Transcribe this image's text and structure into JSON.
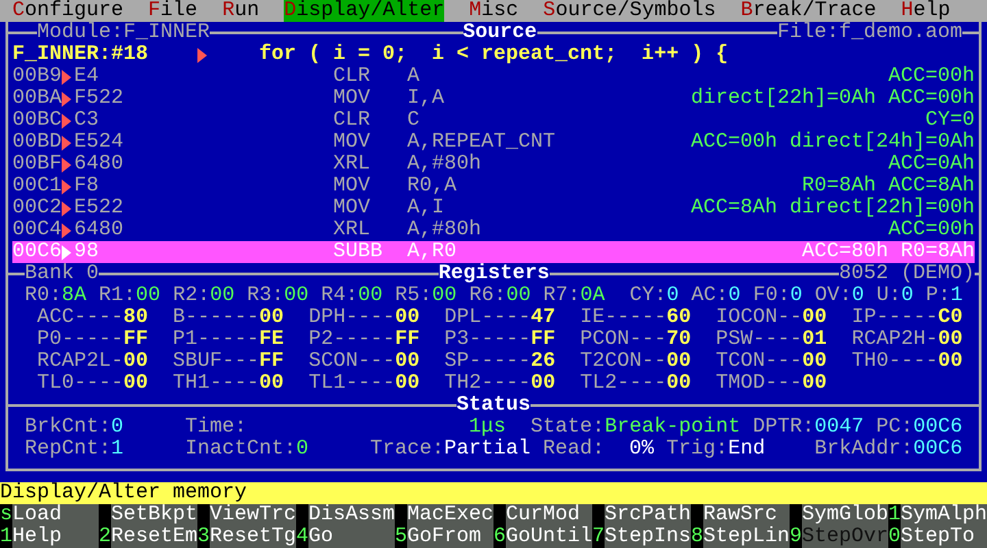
{
  "menu": [
    {
      "label": "Configure",
      "selected": false
    },
    {
      "label": "File",
      "selected": false
    },
    {
      "label": "Run",
      "selected": false
    },
    {
      "label": "Display/Alter",
      "selected": true
    },
    {
      "label": "Misc",
      "selected": false
    },
    {
      "label": "Source/Symbols",
      "selected": false
    },
    {
      "label": "Break/Trace",
      "selected": false
    },
    {
      "label": "Help",
      "selected": false
    }
  ],
  "source_panel": {
    "module": "Module:F_INNER",
    "title": "Source",
    "file": "File:f_demo.aom",
    "source_line": {
      "label": "F_INNER:#18",
      "code": "for ( i = 0;  i < repeat_cnt;  i++ ) {"
    },
    "lines": [
      {
        "address": "00B9",
        "bytes": "E4",
        "mnemonic": "CLR",
        "operands": "A",
        "effect": "ACC=00h",
        "current": false
      },
      {
        "address": "00BA",
        "bytes": "F522",
        "mnemonic": "MOV",
        "operands": "I,A",
        "effect": "direct[22h]=0Ah ACC=00h",
        "current": false
      },
      {
        "address": "00BC",
        "bytes": "C3",
        "mnemonic": "CLR",
        "operands": "C",
        "effect": "CY=0",
        "current": false
      },
      {
        "address": "00BD",
        "bytes": "E524",
        "mnemonic": "MOV",
        "operands": "A,REPEAT_CNT",
        "effect": "ACC=00h direct[24h]=0Ah",
        "current": false
      },
      {
        "address": "00BF",
        "bytes": "6480",
        "mnemonic": "XRL",
        "operands": "A,#80h",
        "effect": "ACC=0Ah",
        "current": false
      },
      {
        "address": "00C1",
        "bytes": "F8",
        "mnemonic": "MOV",
        "operands": "R0,A",
        "effect": "R0=8Ah ACC=8Ah",
        "current": false
      },
      {
        "address": "00C2",
        "bytes": "E522",
        "mnemonic": "MOV",
        "operands": "A,I",
        "effect": "ACC=8Ah direct[22h]=00h",
        "current": false
      },
      {
        "address": "00C4",
        "bytes": "6480",
        "mnemonic": "XRL",
        "operands": "A,#80h",
        "effect": "ACC=00h",
        "current": false
      },
      {
        "address": "00C6",
        "bytes": "98",
        "mnemonic": "SUBB",
        "operands": "A,R0",
        "effect": "ACC=80h R0=8Ah",
        "current": true
      }
    ]
  },
  "registers_panel": {
    "bank": "Bank 0",
    "title": "Registers",
    "cpu": "8052 (DEMO)",
    "bank_registers": [
      {
        "name": "R0:",
        "value": "8A"
      },
      {
        "name": "R1:",
        "value": "00"
      },
      {
        "name": "R2:",
        "value": "00"
      },
      {
        "name": "R3:",
        "value": "00"
      },
      {
        "name": "R4:",
        "value": "00"
      },
      {
        "name": "R5:",
        "value": "00"
      },
      {
        "name": "R6:",
        "value": "00"
      },
      {
        "name": "R7:",
        "value": "0A"
      }
    ],
    "flags": [
      {
        "name": "CY:",
        "value": "0"
      },
      {
        "name": "AC:",
        "value": "0"
      },
      {
        "name": "F0:",
        "value": "0"
      },
      {
        "name": "OV:",
        "value": "0"
      },
      {
        "name": "U:",
        "value": "0"
      },
      {
        "name": "P:",
        "value": "1"
      }
    ],
    "sfr_rows": [
      [
        {
          "label": "ACC----",
          "value": "80"
        },
        {
          "label": "B------",
          "value": "00"
        },
        {
          "label": "DPH----",
          "value": "00"
        },
        {
          "label": "DPL----",
          "value": "47"
        },
        {
          "label": "IE-----",
          "value": "60"
        },
        {
          "label": "IOCON--",
          "value": "00"
        },
        {
          "label": "IP-----",
          "value": "C0"
        }
      ],
      [
        {
          "label": "P0-----",
          "value": "FF"
        },
        {
          "label": "P1-----",
          "value": "FE"
        },
        {
          "label": "P2-----",
          "value": "FF"
        },
        {
          "label": "P3-----",
          "value": "FF"
        },
        {
          "label": "PCON---",
          "value": "70"
        },
        {
          "label": "PSW----",
          "value": "01"
        },
        {
          "label": "RCAP2H-",
          "value": "00"
        }
      ],
      [
        {
          "label": "RCAP2L-",
          "value": "00"
        },
        {
          "label": "SBUF---",
          "value": "FF"
        },
        {
          "label": "SCON---",
          "value": "00"
        },
        {
          "label": "SP-----",
          "value": "26"
        },
        {
          "label": "T2CON--",
          "value": "00"
        },
        {
          "label": "TCON---",
          "value": "00"
        },
        {
          "label": "TH0----",
          "value": "00"
        }
      ],
      [
        {
          "label": "TL0----",
          "value": "00"
        },
        {
          "label": "TH1----",
          "value": "00"
        },
        {
          "label": "TL1----",
          "value": "00"
        },
        {
          "label": "TH2----",
          "value": "00"
        },
        {
          "label": "TL2----",
          "value": "00"
        },
        {
          "label": "TMOD---",
          "value": "00"
        }
      ]
    ]
  },
  "status_panel": {
    "title": "Status",
    "fields": [
      {
        "label": "BrkCnt:",
        "value": "0",
        "color": "#55ffff"
      },
      {
        "label": "Time:",
        "value": "1μs",
        "color": "#55ff55"
      },
      {
        "label": "State:",
        "value": "Break-point",
        "color": "#55ff55"
      },
      {
        "label": "DPTR:",
        "value": "0047",
        "color": "#55ffff"
      },
      {
        "label": "PC:",
        "value": "00C6",
        "color": "#55ffff"
      },
      {
        "label": "RepCnt:",
        "value": "1",
        "color": "#55ffff"
      },
      {
        "label": "InactCnt:",
        "value": "0",
        "color": "#55ff55"
      },
      {
        "label": "Trace:",
        "value": "Partial",
        "color": "#ffffff"
      },
      {
        "label": "Read:",
        "value": "0%",
        "color": "#ffffff"
      },
      {
        "label": "Trig:",
        "value": "End",
        "color": "#ffffff"
      },
      {
        "label": "BrkAddr:",
        "value": "00C6",
        "color": "#55ffff"
      }
    ]
  },
  "message": "Display/Alter memory",
  "function_keys": [
    [
      {
        "key": "s",
        "label": "Load",
        "disabled": false
      },
      {
        "label": "SetBkpt",
        "disabled": false
      },
      {
        "label": "ViewTrc",
        "disabled": false
      },
      {
        "label": "DisAssm",
        "disabled": false
      },
      {
        "label": "MacExec",
        "disabled": false
      },
      {
        "label": "CurMod",
        "disabled": false
      },
      {
        "label": "SrcPath",
        "disabled": false
      },
      {
        "label": "RawSrc",
        "disabled": false
      },
      {
        "label": "SymGlob",
        "disabled": false
      },
      {
        "key": "1",
        "label": "SymAlph",
        "disabled": false
      }
    ],
    [
      {
        "key": "1",
        "label": "Help",
        "disabled": false
      },
      {
        "key": "2",
        "label": "ResetEm",
        "disabled": false
      },
      {
        "key": "3",
        "label": "ResetTg",
        "disabled": false
      },
      {
        "key": "4",
        "label": "Go",
        "disabled": false
      },
      {
        "key": "5",
        "label": "GoFrom",
        "disabled": false
      },
      {
        "key": "6",
        "label": "GoUntil",
        "disabled": false
      },
      {
        "key": "7",
        "label": "StepIns",
        "disabled": false
      },
      {
        "key": "8",
        "label": "StepLin",
        "disabled": false
      },
      {
        "key": "9",
        "label": "StepOvr",
        "disabled": true
      },
      {
        "key": "0",
        "label": "StepTo",
        "disabled": false
      }
    ]
  ]
}
